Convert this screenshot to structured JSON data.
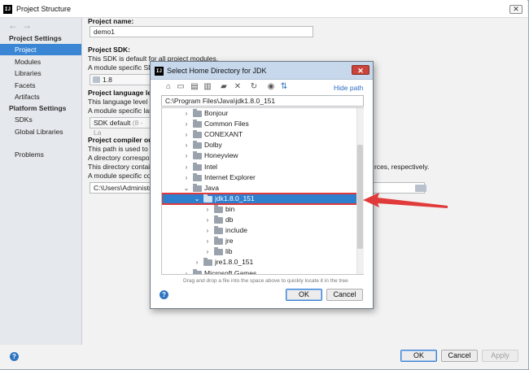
{
  "window": {
    "title": "Project Structure",
    "logo_text": "IJ"
  },
  "sidebar": {
    "nav_back": "←",
    "nav_forward": "→",
    "project_settings_header": "Project Settings",
    "project_settings_items": [
      "Project",
      "Modules",
      "Libraries",
      "Facets",
      "Artifacts"
    ],
    "platform_settings_header": "Platform Settings",
    "platform_settings_items": [
      "SDKs",
      "Global Libraries"
    ],
    "problems": "Problems",
    "selected_item": "Project"
  },
  "main": {
    "project_name_label": "Project name:",
    "project_name_value": "demo1",
    "sdk_label": "Project SDK:",
    "sdk_line1": "This SDK is default for all project modules.",
    "sdk_line2": "A module specific SD",
    "sdk_value": "1.8",
    "lang_label": "Project language lev",
    "lang_line1": "This language level is",
    "lang_line2": "A module specific lan",
    "lang_value": "SDK default",
    "lang_value_hint": "(8 - La",
    "compiler_label": "Project compiler out",
    "compiler_line1": "This path is used to s",
    "compiler_line2": "A directory correspo",
    "compiler_line3": "This directory contain",
    "compiler_line3_tail": "rces, respectively.",
    "compiler_line4": "A module specific co",
    "compiler_value": "C:\\Users\\Administra"
  },
  "buttons": {
    "ok": "OK",
    "cancel": "Cancel",
    "apply": "Apply",
    "help": "?"
  },
  "dialog": {
    "title": "Select Home Directory for JDK",
    "close": "✕",
    "hide_path": "Hide path",
    "path_value": "C:\\Program Files\\Java\\jdk1.8.0_151",
    "toolbar_icons": [
      "home-icon",
      "desktop-icon",
      "project-icon",
      "module-icon",
      "new-folder-icon",
      "delete-icon",
      "refresh-icon",
      "show-hidden-icon",
      "collapse-icon"
    ],
    "tree": [
      {
        "name": "Bonjour",
        "level": 0,
        "expanded": false
      },
      {
        "name": "Common Files",
        "level": 0,
        "expanded": false
      },
      {
        "name": "CONEXANT",
        "level": 0,
        "expanded": false
      },
      {
        "name": "Dolby",
        "level": 0,
        "expanded": false
      },
      {
        "name": "Honeyview",
        "level": 0,
        "expanded": false
      },
      {
        "name": "Intel",
        "level": 0,
        "expanded": false
      },
      {
        "name": "Internet Explorer",
        "level": 0,
        "expanded": false
      },
      {
        "name": "Java",
        "level": 0,
        "expanded": true
      },
      {
        "name": "jdk1.8.0_151",
        "level": 1,
        "expanded": true,
        "selected": true
      },
      {
        "name": "bin",
        "level": 2,
        "expanded": false
      },
      {
        "name": "db",
        "level": 2,
        "expanded": false
      },
      {
        "name": "include",
        "level": 2,
        "expanded": false
      },
      {
        "name": "jre",
        "level": 2,
        "expanded": false
      },
      {
        "name": "lib",
        "level": 2,
        "expanded": false
      },
      {
        "name": "jre1.8.0_151",
        "level": 1,
        "expanded": false
      },
      {
        "name": "Microsoft Games",
        "level": 0,
        "expanded": false
      }
    ],
    "hint": "Drag and drop a file into the space above to quickly locate it in the tree",
    "ok": "OK",
    "cancel": "Cancel",
    "help": "?"
  },
  "colors": {
    "selection": "#2f7fcf",
    "annotation": "#e03a3a",
    "sidebar_selection": "#3a86d4"
  }
}
